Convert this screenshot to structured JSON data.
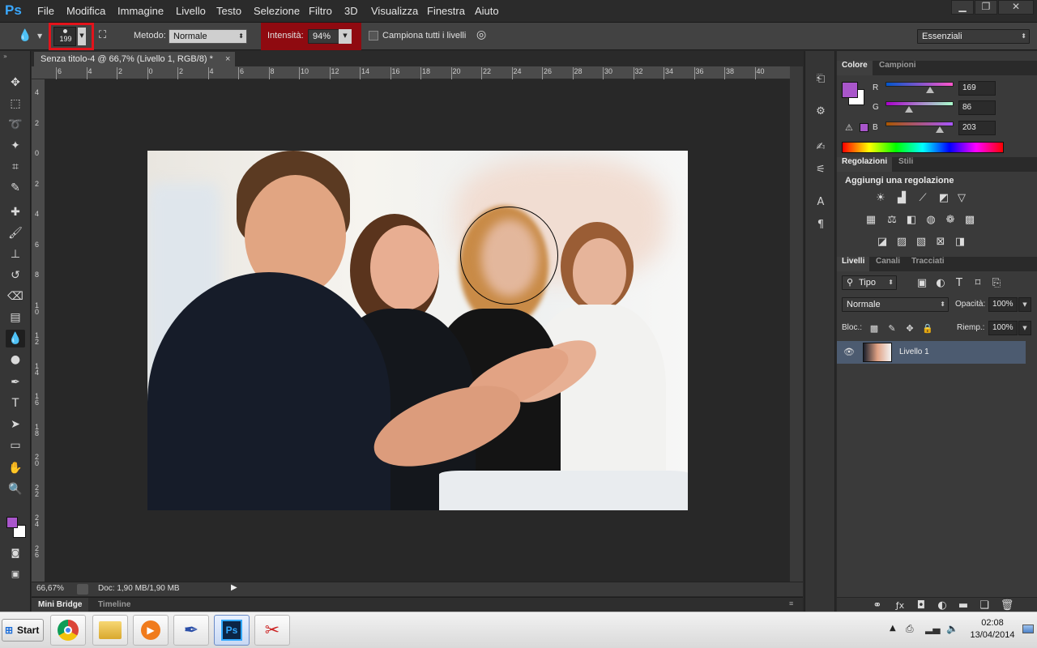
{
  "app": {
    "logo": "Ps",
    "menu": [
      "File",
      "Modifica",
      "Immagine",
      "Livello",
      "Testo",
      "Selezione",
      "Filtro",
      "3D",
      "Visualizza",
      "Finestra",
      "Aiuto"
    ],
    "window_controls": {
      "minimize": "▁",
      "restore": "❐",
      "close": "✕"
    }
  },
  "options": {
    "brush_size": "199",
    "metodo_label": "Metodo:",
    "metodo_value": "Normale",
    "intensita_label": "Intensità:",
    "intensita_value": "94%",
    "campiona_label": "Campiona tutti i livelli",
    "workspace": "Essenziali"
  },
  "document": {
    "tab_title": "Senza titolo-4 @ 66,7% (Livello 1, RGB/8) *",
    "close": "×",
    "ruler_h": [
      "6",
      "4",
      "2",
      "0",
      "2",
      "4",
      "6",
      "8",
      "10",
      "12",
      "14",
      "16",
      "18",
      "20",
      "22",
      "24",
      "26",
      "28",
      "30",
      "32",
      "34",
      "36",
      "38",
      "40"
    ],
    "ruler_v": [
      "4",
      "2",
      "0",
      "2",
      "4",
      "6",
      "8",
      "1 0",
      "1 2",
      "1 4",
      "1 6",
      "1 8",
      "2 0",
      "2 2",
      "2 4",
      "2 6"
    ],
    "zoom": "66,67%",
    "doc_info": "Doc: 1,90 MB/1,90 MB"
  },
  "bottom_tabs": {
    "mini_bridge": "Mini Bridge",
    "timeline": "Timeline"
  },
  "color_panel": {
    "tabs": [
      "Colore",
      "Campioni"
    ],
    "foreground": "#a956cb",
    "r_label": "R",
    "g_label": "G",
    "b_label": "B",
    "r": "169",
    "g": "86",
    "b": "203",
    "r_level": 0.66,
    "g_level": 0.34,
    "b_level": 0.8
  },
  "adjustments_panel": {
    "tabs": [
      "Regolazioni",
      "Stili"
    ],
    "heading": "Aggiungi una regolazione"
  },
  "layers_panel": {
    "tabs": [
      "Livelli",
      "Canali",
      "Tracciati"
    ],
    "filter_label": "Tipo",
    "blend_mode": "Normale",
    "opacity_label": "Opacità:",
    "opacity_value": "100%",
    "lock_label": "Bloc.:",
    "fill_label": "Riemp.:",
    "fill_value": "100%",
    "layers": [
      {
        "name": "Livello 1"
      }
    ]
  },
  "taskbar": {
    "start": "Start",
    "time": "02:08",
    "date": "13/04/2014",
    "ps_label": "Ps"
  }
}
